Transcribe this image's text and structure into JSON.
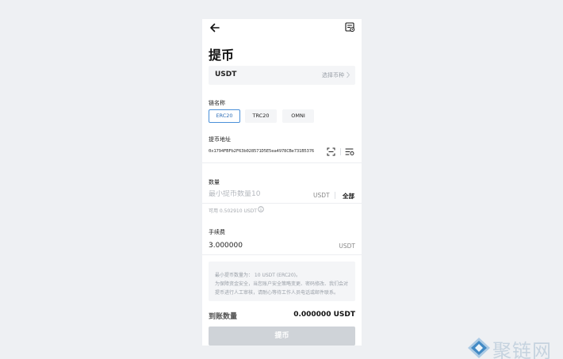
{
  "page": {
    "title": "提币"
  },
  "coin": {
    "name": "USDT",
    "hint": "选择币种"
  },
  "chain": {
    "label": "链名称",
    "options": [
      "ERC20",
      "TRC20",
      "OMNI"
    ],
    "selected": "ERC20"
  },
  "address": {
    "label": "提币地址",
    "value": "0x1794FBFb2F63b028571D5E5ea4978CBe731B5376"
  },
  "amount": {
    "label": "数量",
    "placeholder": "最小提币数量10",
    "unit": "USDT",
    "all_label": "全部",
    "available": "可用 0.502910 USDT"
  },
  "fee": {
    "label": "手续费",
    "value": "3.000000",
    "unit": "USDT"
  },
  "notice": {
    "line1": "最小提币数量为： 10 USDT (ERC20)。",
    "line2": "为保障资金安全，当您账户安全策略变更、密码修改、我们会对提币进行人工审核，请耐心等待工作人员电话或邮件联系。"
  },
  "received": {
    "label": "到账数量",
    "value": "0.000000 USDT"
  },
  "submit": {
    "label": "提币"
  },
  "watermark": {
    "text": "聚链网"
  },
  "icons": {
    "back": "back-arrow-icon",
    "record": "withdraw-record-icon",
    "scan": "scan-icon",
    "address_book": "address-book-icon",
    "info": "info-icon",
    "chevron": "chevron-right-icon"
  },
  "colors": {
    "accent": "#2f6fb8",
    "button_disabled": "#cfd3d8",
    "background": "#eef0f3"
  }
}
